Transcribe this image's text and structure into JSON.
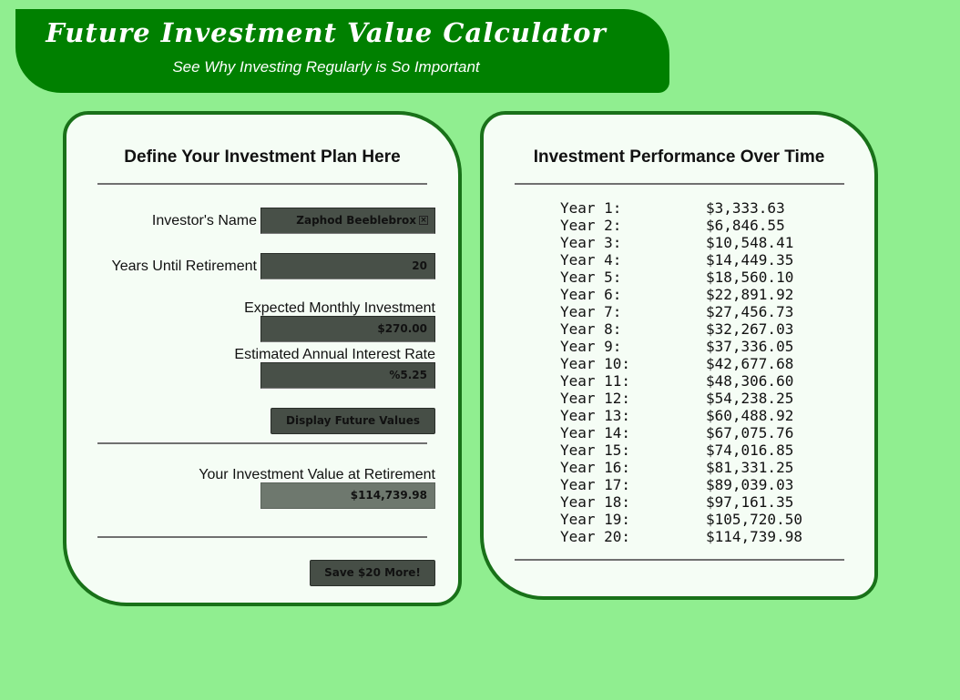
{
  "header": {
    "title": "Future Investment Value Calculator",
    "subtitle": "See Why Investing Regularly is So Important"
  },
  "form": {
    "title": "Define Your Investment Plan Here",
    "name_label": "Investor's Name",
    "name_value": "Zaphod Beeblebrox",
    "years_label": "Years Until Retirement",
    "years_value": "20",
    "monthly_label": "Expected Monthly Investment",
    "monthly_value": "$270.00",
    "rate_label": "Estimated Annual Interest Rate",
    "rate_value": "%5.25",
    "display_button": "Display Future Values",
    "result_label": "Your Investment Value at Retirement",
    "result_value": "$114,739.98",
    "save_button": "Save $20 More!"
  },
  "performance": {
    "title": "Investment Performance Over Time",
    "rows": [
      {
        "label": "Year 1:",
        "value": "$3,333.63"
      },
      {
        "label": "Year 2:",
        "value": "$6,846.55"
      },
      {
        "label": "Year 3:",
        "value": "$10,548.41"
      },
      {
        "label": "Year 4:",
        "value": "$14,449.35"
      },
      {
        "label": "Year 5:",
        "value": "$18,560.10"
      },
      {
        "label": "Year 6:",
        "value": "$22,891.92"
      },
      {
        "label": "Year 7:",
        "value": "$27,456.73"
      },
      {
        "label": "Year 8:",
        "value": "$32,267.03"
      },
      {
        "label": "Year 9:",
        "value": "$37,336.05"
      },
      {
        "label": "Year 10:",
        "value": "$42,677.68"
      },
      {
        "label": "Year 11:",
        "value": "$48,306.60"
      },
      {
        "label": "Year 12:",
        "value": "$54,238.25"
      },
      {
        "label": "Year 13:",
        "value": "$60,488.92"
      },
      {
        "label": "Year 14:",
        "value": "$67,075.76"
      },
      {
        "label": "Year 15:",
        "value": "$74,016.85"
      },
      {
        "label": "Year 16:",
        "value": "$81,331.25"
      },
      {
        "label": "Year 17:",
        "value": "$89,039.03"
      },
      {
        "label": "Year 18:",
        "value": "$97,161.35"
      },
      {
        "label": "Year 19:",
        "value": "$105,720.50"
      },
      {
        "label": "Year 20:",
        "value": "$114,739.98"
      }
    ]
  },
  "icons": {
    "clear": "clear-x-icon"
  },
  "colors": {
    "background": "#90ee90",
    "header": "#008000",
    "panel_border": "#197119",
    "panel_bg": "#f5fdf5"
  }
}
